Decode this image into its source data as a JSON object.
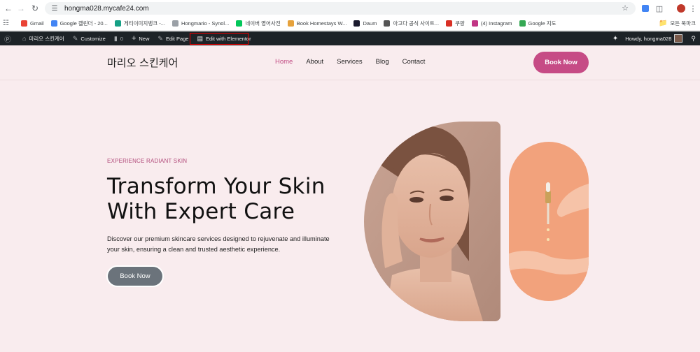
{
  "browser": {
    "url": "hongma028.mycafe24.com",
    "bookmarks": [
      {
        "label": "Gmail",
        "color": "#ea4335"
      },
      {
        "label": "Google 캘린더 - 20...",
        "color": "#4285f4"
      },
      {
        "label": "게티이미지뱅크 -...",
        "color": "#16a085"
      },
      {
        "label": "Hongmario - Synol...",
        "color": "#9aa0a6"
      },
      {
        "label": "네이버 영어사전",
        "color": "#03c75a"
      },
      {
        "label": "Book Homestays W...",
        "color": "#e6a23c"
      },
      {
        "label": "Daum",
        "color": "#1a1a2e"
      },
      {
        "label": "아고다 공식 사이트...",
        "color": "#555555"
      },
      {
        "label": "쿠팡",
        "color": "#d93025"
      },
      {
        "label": "(4) Instagram",
        "color": "#c13584"
      },
      {
        "label": "Google 지도",
        "color": "#34a853"
      }
    ],
    "all_bookmarks": "모든 북마크"
  },
  "wp_admin_bar": {
    "site_name": "마리오 스킨케어",
    "customize": "Customize",
    "comments_count": "0",
    "new": "New",
    "edit_page": "Edit Page",
    "edit_elementor": "Edit with Elementor",
    "howdy": "Howdy, hongma028"
  },
  "site": {
    "logo": "마리오 스킨케어",
    "menu": [
      {
        "label": "Home",
        "active": true
      },
      {
        "label": "About",
        "active": false
      },
      {
        "label": "Services",
        "active": false
      },
      {
        "label": "Blog",
        "active": false
      },
      {
        "label": "Contact",
        "active": false
      }
    ],
    "header_cta": "Book Now",
    "hero": {
      "eyebrow": "EXPERIENCE RADIANT SKIN",
      "headline_line1": "Transform Your Skin",
      "headline_line2": "With Expert Care",
      "description": "Discover our premium skincare services designed to rejuvenate and illuminate your skin, ensuring a clean and trusted aesthetic experience.",
      "cta": "Book Now"
    }
  },
  "colors": {
    "accent": "#c64b85",
    "page_bg": "#f9ecee",
    "wpbar_bg": "#1d2327"
  }
}
